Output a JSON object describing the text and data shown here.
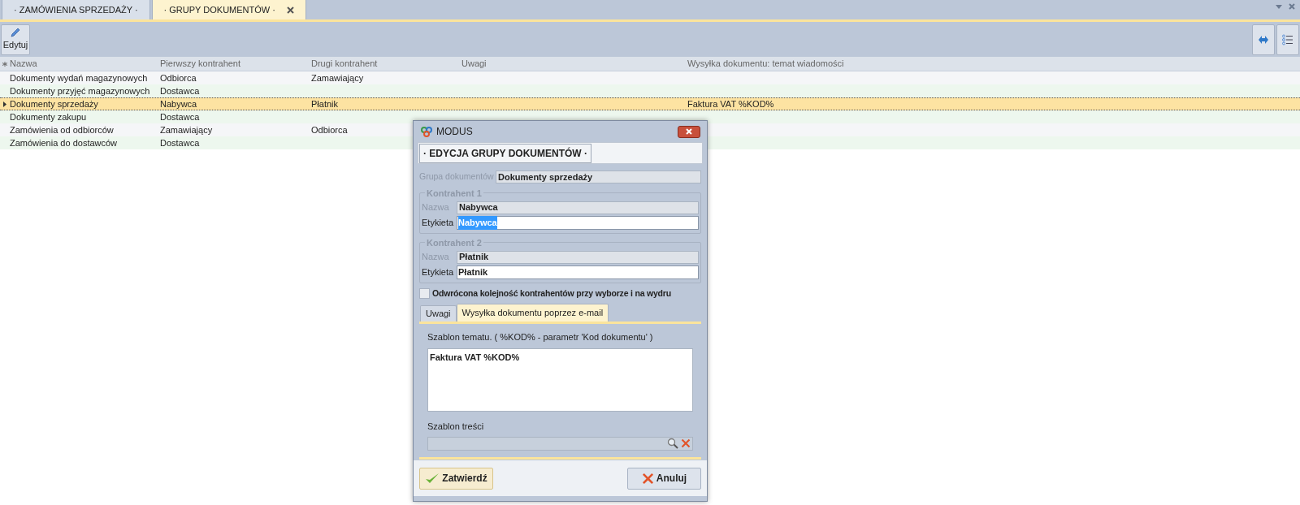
{
  "tabs": [
    {
      "label": "· ZAMÓWIENIA SPRZEDAŻY ·",
      "selected": false,
      "closable": false
    },
    {
      "label": "· GRUPY DOKUMENTÓW ·",
      "selected": true,
      "closable": true
    }
  ],
  "toolbar": {
    "buttons": [
      {
        "label": "Edytuj"
      }
    ]
  },
  "table": {
    "columns": [
      "Nazwa",
      "Pierwszy kontrahent",
      "Drugi kontrahent",
      "Uwagi",
      "Wysyłka dokumentu: temat wiadomości"
    ],
    "rows": [
      {
        "cells": [
          "Dokumenty wydań magazynowych",
          "Odbiorca",
          "Zamawiający",
          "",
          ""
        ],
        "selected": false
      },
      {
        "cells": [
          "Dokumenty przyjęć magazynowych",
          "Dostawca",
          "",
          "",
          ""
        ],
        "selected": false
      },
      {
        "cells": [
          "Dokumenty sprzedaży",
          "Nabywca",
          "Płatnik",
          "",
          "Faktura VAT %KOD%"
        ],
        "selected": true
      },
      {
        "cells": [
          "Dokumenty zakupu",
          "Dostawca",
          "",
          "",
          ""
        ],
        "selected": false
      },
      {
        "cells": [
          "Zamówienia od odbiorców",
          "Zamawiający",
          "Odbiorca",
          "",
          ""
        ],
        "selected": false
      },
      {
        "cells": [
          "Zamówienia do dostawców",
          "Dostawca",
          "",
          "",
          ""
        ],
        "selected": false
      }
    ]
  },
  "dialog": {
    "title": "MODUS",
    "header": "· EDYCJA GRUPY DOKUMENTÓW ·",
    "group_field": {
      "label": "Grupa dokumentów",
      "value": "Dokumenty sprzedaży"
    },
    "contractors": [
      {
        "legend": "Kontrahent 1",
        "name_label": "Nazwa",
        "name_value": "Nabywca",
        "tag_label": "Etykieta",
        "tag_value": "Nabywca",
        "highlighted": true
      },
      {
        "legend": "Kontrahent 2",
        "name_label": "Nazwa",
        "name_value": "Płatnik",
        "tag_label": "Etykieta",
        "tag_value": "Płatnik",
        "highlighted": false
      }
    ],
    "reverse_order": {
      "label": "Odwrócona kolejność kontrahentów przy wyborze i na wydru",
      "checked": false
    },
    "tabs": [
      {
        "label": "Uwagi",
        "selected": false
      },
      {
        "label": "Wysyłka dokumentu poprzez e-mail",
        "selected": true
      }
    ],
    "subject": {
      "label": "Szablon tematu. ( %KOD% - parametr 'Kod dokumentu' )",
      "value": "Faktura VAT %KOD%"
    },
    "body_template": {
      "label": "Szablon treści"
    },
    "buttons": [
      {
        "label": "Zatwierdź",
        "kind": "confirm"
      },
      {
        "label": "Anuluj",
        "kind": "cancel"
      }
    ]
  }
}
